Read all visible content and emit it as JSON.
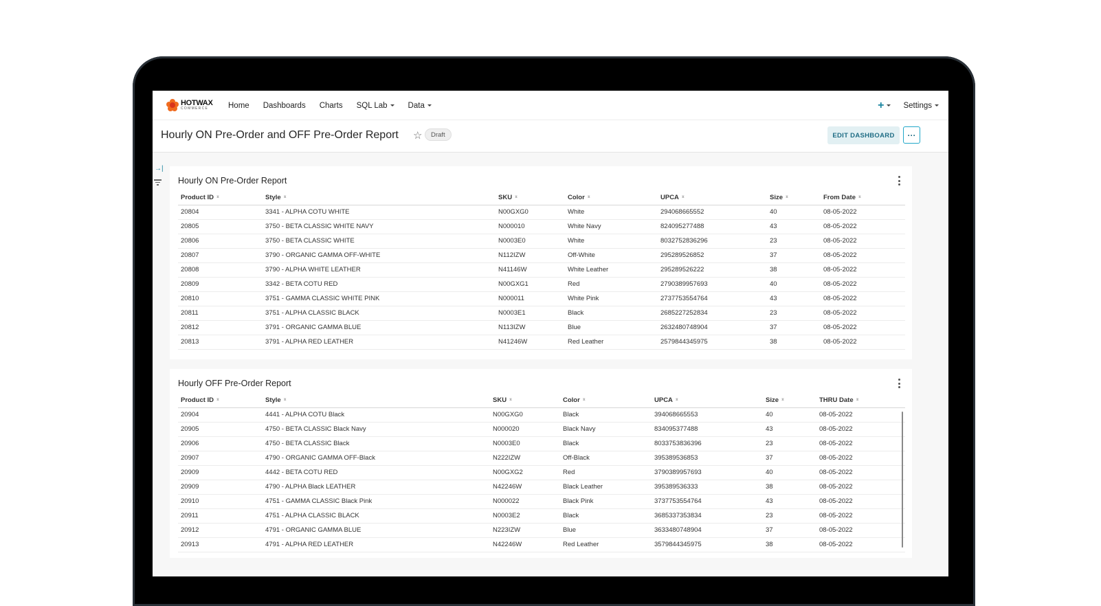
{
  "nav": {
    "logo_main": "HOTWAX",
    "logo_sub": "COMMERCE",
    "items": [
      {
        "label": "Home",
        "dropdown": false
      },
      {
        "label": "Dashboards",
        "dropdown": false
      },
      {
        "label": "Charts",
        "dropdown": false
      },
      {
        "label": "SQL Lab",
        "dropdown": true
      },
      {
        "label": "Data",
        "dropdown": true
      }
    ],
    "plus_icon": "+",
    "settings_label": "Settings",
    "accent_color": "#1a85a0"
  },
  "dashboard": {
    "title": "Hourly ON Pre-Order and OFF Pre-Order Report",
    "star_icon": "☆",
    "status_badge": "Draft",
    "edit_button": "EDIT DASHBOARD",
    "more_button": "···"
  },
  "rail": {
    "expand_icon": "→|"
  },
  "on_report": {
    "title": "Hourly ON Pre-Order Report",
    "columns": [
      "Product ID",
      "Style",
      "SKU",
      "Color",
      "UPCA",
      "Size",
      "From Date"
    ],
    "rows": [
      [
        "20804",
        "3341 - ALPHA COTU WHITE",
        "N00GXG0",
        "White",
        "294068665552",
        "40",
        "08-05-2022"
      ],
      [
        "20805",
        "3750 - BETA CLASSIC WHITE NAVY",
        "N000010",
        "White Navy",
        "824095277488",
        "43",
        "08-05-2022"
      ],
      [
        "20806",
        "3750 - BETA CLASSIC WHITE",
        "N0003E0",
        "White",
        "8032752836296",
        "23",
        "08-05-2022"
      ],
      [
        "20807",
        "3790 - ORGANIC GAMMA OFF-WHITE",
        "N112IZW",
        "Off-White",
        "295289526852",
        "37",
        "08-05-2022"
      ],
      [
        "20808",
        "3790 - ALPHA WHITE LEATHER",
        "N41146W",
        "White Leather",
        "295289526222",
        "38",
        "08-05-2022"
      ],
      [
        "20809",
        "3342 - BETA COTU RED",
        "N00GXG1",
        "Red",
        "2790389957693",
        "40",
        "08-05-2022"
      ],
      [
        "20810",
        "3751 - GAMMA CLASSIC WHITE PINK",
        "N000011",
        "White Pink",
        "2737753554764",
        "43",
        "08-05-2022"
      ],
      [
        "20811",
        "3751 - ALPHA CLASSIC BLACK",
        "N0003E1",
        "Black",
        "2685227252834",
        "23",
        "08-05-2022"
      ],
      [
        "20812",
        "3791 - ORGANIC GAMMA BLUE",
        "N113IZW",
        "Blue",
        "2632480748904",
        "37",
        "08-05-2022"
      ],
      [
        "20813",
        "3791 - ALPHA RED LEATHER",
        "N41246W",
        "Red Leather",
        "2579844345975",
        "38",
        "08-05-2022"
      ]
    ]
  },
  "off_report": {
    "title": "Hourly OFF Pre-Order Report",
    "columns": [
      "Product ID",
      "Style",
      "SKU",
      "Color",
      "UPCA",
      "Size",
      "THRU Date"
    ],
    "rows": [
      [
        "20904",
        "4441 - ALPHA COTU Black",
        "N00GXG0",
        "Black",
        "394068665553",
        "40",
        "08-05-2022"
      ],
      [
        "20905",
        "4750 - BETA CLASSIC Black Navy",
        "N000020",
        "Black Navy",
        "834095377488",
        "43",
        "08-05-2022"
      ],
      [
        "20906",
        "4750 - BETA CLASSIC Black",
        "N0003E0",
        "Black",
        "8033753836396",
        "23",
        "08-05-2022"
      ],
      [
        "20907",
        "4790 - ORGANIC GAMMA OFF-Black",
        "N222IZW",
        "Off-Black",
        "395389536853",
        "37",
        "08-05-2022"
      ],
      [
        "20909",
        "4442 - BETA COTU RED",
        "N00GXG2",
        "Red",
        "3790389957693",
        "40",
        "08-05-2022"
      ],
      [
        "20909",
        "4790 - ALPHA Black LEATHER",
        "N42246W",
        "Black Leather",
        "395389536333",
        "38",
        "08-05-2022"
      ],
      [
        "20910",
        "4751 - GAMMA CLASSIC Black Pink",
        "N000022",
        "Black Pink",
        "3737753554764",
        "43",
        "08-05-2022"
      ],
      [
        "20911",
        "4751 - ALPHA CLASSIC BLACK",
        "N0003E2",
        "Black",
        "3685337353834",
        "23",
        "08-05-2022"
      ],
      [
        "20912",
        "4791 - ORGANIC GAMMA BLUE",
        "N223IZW",
        "Blue",
        "3633480748904",
        "37",
        "08-05-2022"
      ],
      [
        "20913",
        "4791 - ALPHA RED LEATHER",
        "N42246W",
        "Red Leather",
        "3579844345975",
        "38",
        "08-05-2022"
      ]
    ]
  }
}
